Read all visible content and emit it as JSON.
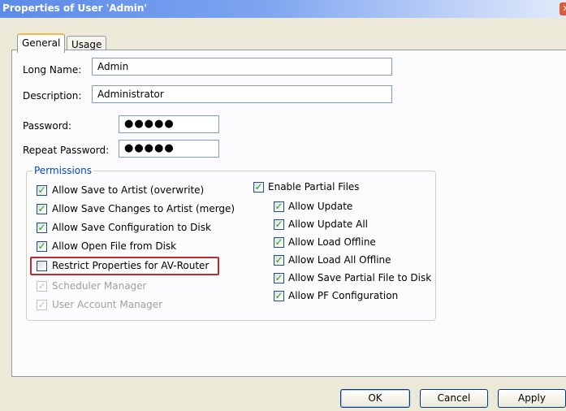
{
  "window": {
    "title": "Properties of User 'Admin'"
  },
  "tabs": [
    {
      "label": "General",
      "active": true
    },
    {
      "label": "Usage",
      "active": false
    }
  ],
  "form": {
    "long_name_label": "Long Name:",
    "long_name_value": "Admin",
    "description_label": "Description:",
    "description_value": "Administrator",
    "password_label": "Password:",
    "password_value": "●●●●●",
    "repeat_password_label": "Repeat Password:",
    "repeat_password_value": "●●●●●"
  },
  "permissions": {
    "group_label": "Permissions",
    "left": [
      {
        "label": "Allow Save to Artist (overwrite)",
        "checked": true,
        "enabled": true
      },
      {
        "label": "Allow Save Changes to Artist (merge)",
        "checked": true,
        "enabled": true
      },
      {
        "label": "Allow Save Configuration to Disk",
        "checked": true,
        "enabled": true
      },
      {
        "label": "Allow Open File from Disk",
        "checked": true,
        "enabled": true
      },
      {
        "label": "Restrict Properties for AV-Router",
        "checked": false,
        "enabled": true,
        "highlighted": true
      },
      {
        "label": "Scheduler Manager",
        "checked": true,
        "enabled": false
      },
      {
        "label": "User Account Manager",
        "checked": true,
        "enabled": false
      }
    ],
    "partial_files": {
      "label": "Enable Partial Files",
      "checked": true
    },
    "right": [
      {
        "label": "Allow Update",
        "checked": true
      },
      {
        "label": "Allow Update All",
        "checked": true
      },
      {
        "label": "Allow Load Offline",
        "checked": true
      },
      {
        "label": "Allow Load All Offline",
        "checked": true
      },
      {
        "label": "Allow Save Partial File to Disk",
        "checked": true
      },
      {
        "label": "Allow PF Configuration",
        "checked": true
      }
    ]
  },
  "buttons": {
    "ok": "OK",
    "cancel": "Cancel",
    "apply": "Apply"
  },
  "colors": {
    "highlight_box": "#c0292e",
    "group_title": "#0046d5",
    "check": "#21a121"
  },
  "icons": {
    "checkbox_checked": "checkmark",
    "close": "close-icon"
  }
}
